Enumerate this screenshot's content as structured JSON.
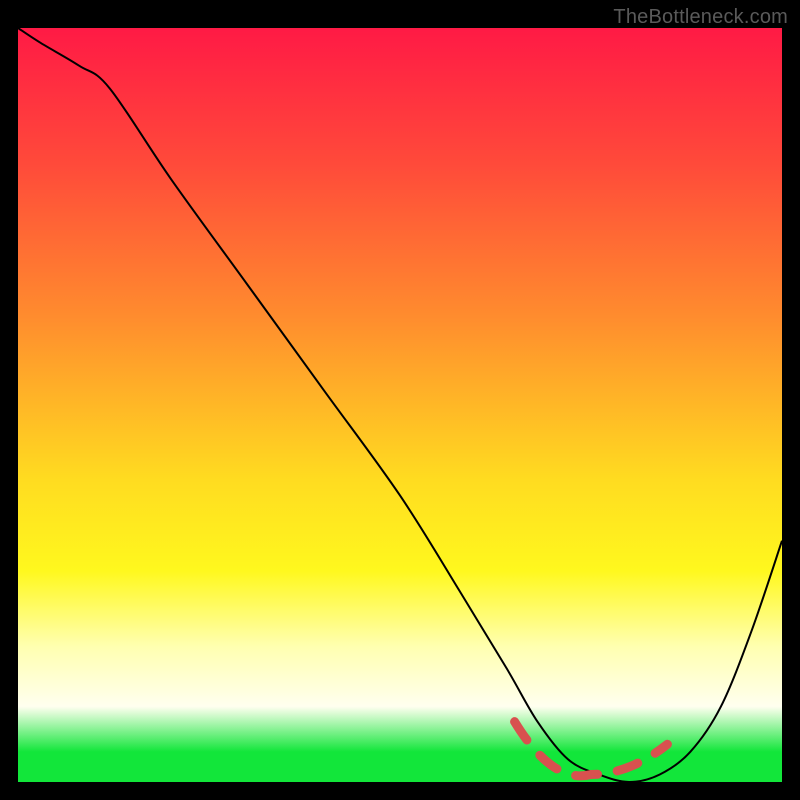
{
  "watermark": "TheBottleneck.com",
  "chart_data": {
    "type": "line",
    "title": "",
    "xlabel": "",
    "ylabel": "",
    "xlim": [
      0,
      100
    ],
    "ylim": [
      0,
      100
    ],
    "grid": false,
    "legend": false,
    "series": [
      {
        "name": "bottleneck-curve",
        "color": "#000000",
        "x": [
          0,
          3,
          8,
          12,
          20,
          30,
          40,
          50,
          58,
          64,
          68,
          72,
          76,
          80,
          84,
          88,
          92,
          96,
          100
        ],
        "y": [
          100,
          98,
          95,
          92,
          80,
          66,
          52,
          38,
          25,
          15,
          8,
          3,
          1,
          0,
          1,
          4,
          10,
          20,
          32
        ]
      },
      {
        "name": "optimal-range-marker",
        "color": "#d8514f",
        "x": [
          65,
          85
        ],
        "y": [
          3,
          3
        ]
      }
    ],
    "annotations": []
  }
}
